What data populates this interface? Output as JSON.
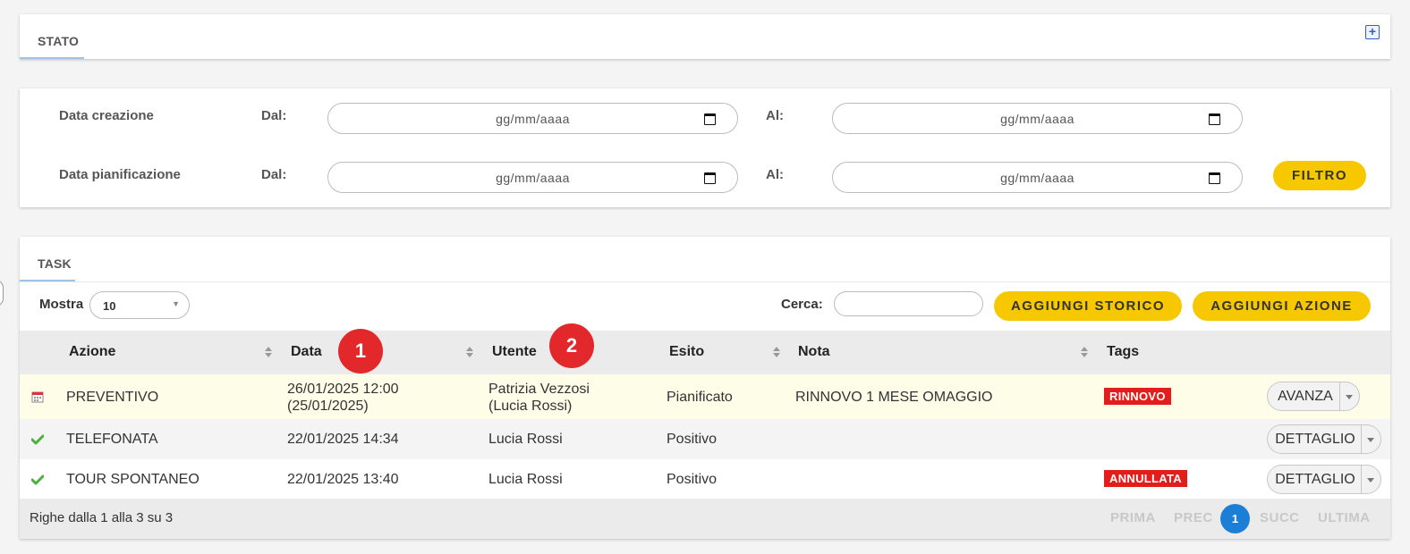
{
  "stato": {
    "title": "STATO",
    "expand_icon": "plus-square-icon"
  },
  "filter": {
    "rows": [
      {
        "label": "Data creazione",
        "dal_label": "Dal:",
        "al_label": "Al:",
        "dal_placeholder": "gg/mm/aaaa",
        "al_placeholder": "gg/mm/aaaa"
      },
      {
        "label": "Data pianificazione",
        "dal_label": "Dal:",
        "al_label": "Al:",
        "dal_placeholder": "gg/mm/aaaa",
        "al_placeholder": "gg/mm/aaaa"
      }
    ],
    "button": "FILTRO"
  },
  "task": {
    "title": "TASK",
    "mostra_label": "Mostra",
    "mostra_value": "10",
    "cerca_label": "Cerca:",
    "search_value": "",
    "add_history_button": "AGGIUNGI STORICO",
    "add_action_button": "AGGIUNGI AZIONE",
    "columns": [
      "Azione",
      "Data",
      "Utente",
      "Esito",
      "Nota",
      "Tags"
    ],
    "badges": [
      "1",
      "2"
    ],
    "rows": [
      {
        "icon": "calendar-icon",
        "azione": "PREVENTIVO",
        "data_line1": "26/01/2025 12:00",
        "data_line2": "(25/01/2025)",
        "utente_line1": "Patrizia Vezzosi",
        "utente_line2": "(Lucia Rossi)",
        "esito": "Pianificato",
        "nota": "RINNOVO 1 MESE OMAGGIO",
        "tag": "RINNOVO",
        "action": "AVANZA"
      },
      {
        "icon": "checkmark-icon",
        "azione": "TELEFONATA",
        "data_line1": "22/01/2025 14:34",
        "data_line2": "",
        "utente_line1": "Lucia Rossi",
        "utente_line2": "",
        "esito": "Positivo",
        "nota": "",
        "tag": "",
        "action": "DETTAGLIO"
      },
      {
        "icon": "checkmark-icon",
        "azione": "TOUR SPONTANEO",
        "data_line1": "22/01/2025 13:40",
        "data_line2": "",
        "utente_line1": "Lucia Rossi",
        "utente_line2": "",
        "esito": "Positivo",
        "nota": "",
        "tag": "ANNULLATA",
        "action": "DETTAGLIO"
      }
    ],
    "footer_info": "Righe dalla 1 alla 3 su 3",
    "pagination": {
      "first": "PRIMA",
      "prev": "PREC",
      "current": "1",
      "next": "SUCC",
      "last": "ULTIMA"
    }
  },
  "colors": {
    "accent_yellow": "#f7c800",
    "tag_red": "#e31c1c",
    "badge_red": "#e2282b",
    "page_blue": "#1b7fd8",
    "highlight_row": "#fdfde8"
  }
}
